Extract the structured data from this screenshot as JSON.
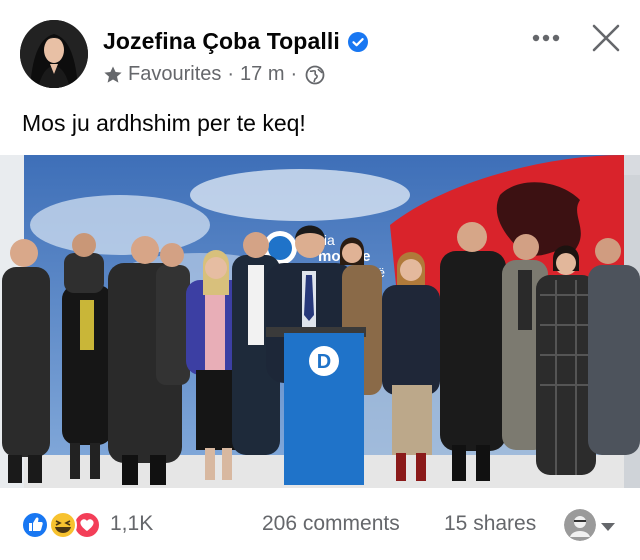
{
  "post": {
    "author": "Jozefina Çoba Topalli",
    "audience_label": "Favourites",
    "time": "17 m",
    "separator": "·",
    "caption": "Mos ju ardhshim per te keq!"
  },
  "photo": {
    "banner_text_top": "tia",
    "banner_text_mid": "mo tike",
    "banner_text_low": "risë",
    "podium_logo": "D"
  },
  "footer": {
    "reaction_count": "1,1K",
    "comments": "206 comments",
    "shares": "15 shares"
  },
  "colors": {
    "facebook_blue": "#1877f2",
    "text_secondary": "#65676b",
    "party_blue": "#1f73c9",
    "flag_red": "#d9232b"
  },
  "icons": {
    "verified": "verified-badge-icon",
    "favourites": "star-icon",
    "audience": "globe-icon",
    "more": "more-horizontal-icon",
    "close": "close-icon",
    "like": "like-reaction-icon",
    "haha": "haha-reaction-icon",
    "love": "love-reaction-icon",
    "caret": "caret-down-icon"
  }
}
